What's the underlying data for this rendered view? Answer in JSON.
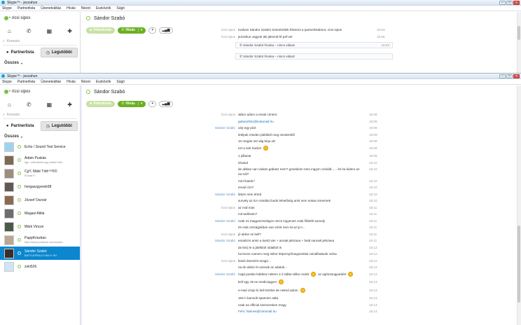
{
  "app": {
    "title": "Skype™ - jezzahun",
    "menu": [
      "Skype",
      "Partnerlista",
      "Üzenetváltás",
      "Hívás",
      "Nézet",
      "Eszközök",
      "Súgó"
    ]
  },
  "profile": {
    "name": "ricsi sipos"
  },
  "search": {
    "placeholder": "Keresés"
  },
  "tabs": {
    "contacts": "Partnerlista",
    "recent": "Legutóbbi"
  },
  "list_header": "Összes",
  "contacts": [
    {
      "name": "Echo / Sound Test Service",
      "mood": ""
    },
    {
      "name": "Ádám Puskás",
      "mood": "ligu, reftorántár egy életért biD.."
    },
    {
      "name": "CgY, Máté Tóth™®©",
      "mood": "ECfaa??"
    },
    {
      "name": "horgaszgyerek98",
      "mood": ""
    },
    {
      "name": "József Oszvár",
      "mood": ""
    },
    {
      "name": "Magasi Attila",
      "mood": ""
    },
    {
      "name": "Márk Vincze",
      "mood": ""
    },
    {
      "name": "PappKrisztian",
      "mood": "http://www.youtube.com/watch..."
    },
    {
      "name": "Sándor Szabó",
      "mood": "BATTLEFIELD FAN !!! XD"
    },
    {
      "name": "zoki526",
      "mood": ""
    }
  ],
  "chat": {
    "partner": "Sándor Szabó",
    "video_label": "Videohívás",
    "call_label": "Hívás",
    "add_label": "+",
    "signal_label": "▂▄▆"
  },
  "back_messages": [
    {
      "sender": "ricsi sipos",
      "text": "Kedves Sándor Szabó! Szeretnélek felvenni a partnerlistámra. ricsi sipos",
      "time": "15:53"
    },
    {
      "sender": "ricsi sipos",
      "text": "jezzahun vagyok aki játszott bf p4f-vel",
      "time": "15:55"
    },
    {
      "sender": "",
      "text": "Sándor Szabó hívása – nincs válasz",
      "time": "15:56"
    },
    {
      "sender": "",
      "text": "Sándor Szabó hívása – nincs válasz",
      "time": ""
    }
  ],
  "messages": [
    {
      "sender": "ricsi sipos",
      "text": "akkor adom a email címem:",
      "time": "16:09"
    },
    {
      "sender": "",
      "text": "gabeszh91@indamail.hu",
      "time": "16:09",
      "link": true
    },
    {
      "sender": "Sándor Szabó",
      "text": "várj egy picit",
      "time": "16:09"
    },
    {
      "sender": "",
      "text": "lelépek minden játékból meg mindenből",
      "time": "16:09"
    },
    {
      "sender": "",
      "text": "10 megás net alig birja xD",
      "time": "16:09"
    },
    {
      "sender": "",
      "text": "ezt a sok hacker",
      "time": "16:09",
      "smile": true
    },
    {
      "sender": "",
      "text": "1 pillanat",
      "time": "16:09"
    },
    {
      "sender": "",
      "text": "irhatod",
      "time": "16:10"
    },
    {
      "sender": "",
      "text": "de abban van valami gabasz nem? gondolom nem ingyen csináld...... és ha kideru az ea-nál?",
      "time": "16:10"
    },
    {
      "sender": "",
      "text": "mit irhatok?",
      "time": "16:10"
    },
    {
      "sender": "",
      "text": "email cím?",
      "time": "16:10"
    },
    {
      "sender": "Sándor Szabó",
      "text": "látom nem érted",
      "time": "16:10"
    },
    {
      "sender": "",
      "text": "survely az EA csinálta funds lehetőség amit nem sokan ismernek",
      "time": "16:10"
    },
    {
      "sender": "ricsi sipos",
      "text": "az mál más",
      "time": "16:11"
    },
    {
      "sender": "",
      "text": "mit tadlinam?",
      "time": "16:11"
    },
    {
      "sender": "Sándor Szabó",
      "text": "csak mi magyarországon nincs ingyenes csak főleték survely",
      "time": "16:11"
    },
    {
      "sender": "",
      "text": "és más országokban van ezért nem át az ip-t...",
      "time": "16:11"
    },
    {
      "sender": "ricsi sipos",
      "text": "jó akkor mi kell?",
      "time": "16:11"
    },
    {
      "sender": "Sándor Szabó",
      "text": "emailcím amin a kartd van + annak jelszava + baitt vannak jelszava",
      "time": "16:11"
    },
    {
      "sender": "",
      "text": "da kézj le a játékból oldalból is",
      "time": "16:12"
    },
    {
      "sender": "",
      "text": "ha lenne camem meg mikor képernyőmegosztást csinálhattunk volna",
      "time": "16:12"
    },
    {
      "sender": "ricsi sipos",
      "text": "biosit átveniés-szagó...",
      "time": "16:12"
    },
    {
      "sender": "",
      "text": "na de akkor itt vannak az adatok...",
      "time": "16:12"
    },
    {
      "sender": "Sándor Szabó",
      "text": "majd postán küldesz nekem 1-2 tábla milka csokit",
      "time": "16:13",
      "smile": true,
      "extra": "az egészangyaráért",
      "smile2": true
    },
    {
      "sender": "",
      "text": "kell egy 19 es mediciagyen",
      "time": "16:13",
      "smile": true
    },
    {
      "sender": "",
      "text": "e-mail címje ki kell törölve de neked adom",
      "time": "16:13",
      "smile": true
    },
    {
      "sender": "",
      "text": "164-n bannolt spamom adta",
      "time": "16:13"
    },
    {
      "sender": "",
      "text": "csak ea official szervereken megy",
      "time": "16:13"
    },
    {
      "sender": "",
      "text": "Fehi: hdenes@citromail.hu",
      "time": "16:14",
      "link": true
    }
  ]
}
